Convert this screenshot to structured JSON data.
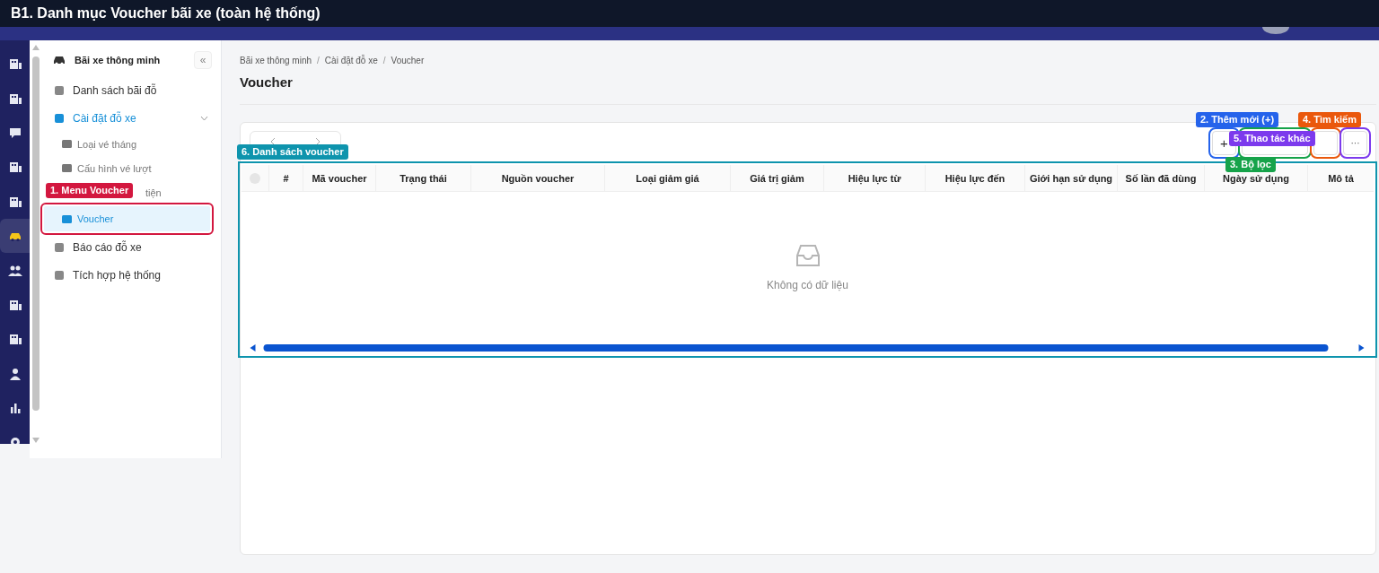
{
  "header": {
    "title": "B1. Danh mục Voucher bãi xe (toàn hệ thống)"
  },
  "rail": [
    {
      "selected": false
    },
    {
      "selected": false
    },
    {
      "selected": false
    },
    {
      "selected": false
    },
    {
      "selected": false
    },
    {
      "selected": true
    },
    {
      "selected": false
    },
    {
      "selected": false
    },
    {
      "selected": false
    },
    {
      "selected": false
    },
    {
      "selected": false
    },
    {
      "selected": false
    }
  ],
  "sidebar": {
    "title": "Bãi xe thông minh",
    "collapse": "«",
    "items": [
      {
        "label": "Danh sách bãi đỗ",
        "selected": false
      },
      {
        "label": "Cài đặt đỗ xe",
        "selected": true,
        "expanded": true,
        "children": [
          {
            "label": "Loại vé tháng",
            "selected": false
          },
          {
            "label": "Cấu hình vé lượt",
            "selected": false
          },
          {
            "label": "tiện",
            "selected": false,
            "kind": "partial"
          },
          {
            "label": "Voucher",
            "selected": true
          }
        ]
      },
      {
        "label": "Báo cáo đỗ xe",
        "selected": false
      },
      {
        "label": "Tích hợp hệ thống",
        "selected": false
      }
    ]
  },
  "breadcrumb": {
    "separator": "/",
    "items": [
      "Bãi xe thông minh",
      "Cài đặt đỗ xe",
      "Voucher"
    ]
  },
  "page_title": "Voucher",
  "toolbar": {
    "add": "+",
    "more": "···"
  },
  "table": {
    "select_all": {
      "checked": false
    },
    "columns": [
      "#",
      "Mã voucher",
      "Trạng thái",
      "Nguồn voucher",
      "Loại giảm giá",
      "Giá trị giảm",
      "Hiệu lực từ",
      "Hiệu lực đến",
      "Giới hạn sử dụng",
      "Số lần đã dùng",
      "Ngày sử dụng",
      "Mô tả"
    ],
    "empty": "Không có dữ liệu"
  },
  "annotations": [
    {
      "kind": "menu",
      "text": "1. Menu Voucher",
      "color": "#d3173f"
    },
    {
      "kind": "add",
      "text": "2. Thêm mới (+)",
      "color": "#2563eb"
    },
    {
      "kind": "filter",
      "text": "3. Bộ lọc",
      "color": "#16a34a"
    },
    {
      "kind": "search",
      "text": "4. Tìm kiếm",
      "color": "#ea580c"
    },
    {
      "kind": "more",
      "text": "5. Thao tác khác",
      "color": "#7c3aed"
    },
    {
      "kind": "table",
      "text": "6. Danh sách voucher",
      "color": "#0e94ad"
    }
  ]
}
